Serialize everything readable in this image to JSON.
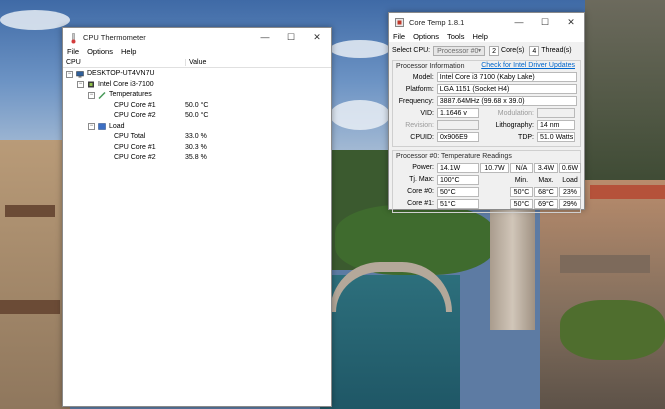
{
  "thermometer": {
    "title": "CPU Thermometer",
    "menu": [
      "File",
      "Options",
      "Help"
    ],
    "columns": {
      "name": "CPU",
      "value": "Value"
    },
    "tree": {
      "computer": "DESKTOP-UT4VN7U",
      "cpu": "Intel Core i3-7100",
      "temperatures_label": "Temperatures",
      "temperatures": [
        {
          "name": "CPU Core #1",
          "value": "50.0 °C"
        },
        {
          "name": "CPU Core #2",
          "value": "50.0 °C"
        }
      ],
      "load_label": "Load",
      "load": [
        {
          "name": "CPU Total",
          "value": "33.0 %"
        },
        {
          "name": "CPU Core #1",
          "value": "30.3 %"
        },
        {
          "name": "CPU Core #2",
          "value": "35.8 %"
        }
      ]
    }
  },
  "coretemp": {
    "title": "Core Temp 1.8.1",
    "menu": [
      "File",
      "Options",
      "Tools",
      "Help"
    ],
    "select_cpu_label": "Select CPU:",
    "select_cpu_value": "Processor #0",
    "cores_count": "2",
    "cores_label": "Core(s)",
    "threads_count": "4",
    "threads_label": "Thread(s)",
    "processor_info_label": "Processor Information",
    "driver_link": "Check for Intel Driver Updates",
    "model_label": "Model:",
    "model": "Intel Core i3 7100 (Kaby Lake)",
    "platform_label": "Platform:",
    "platform": "LGA 1151 (Socket H4)",
    "frequency_label": "Frequency:",
    "frequency": "3887.64MHz (99.68 x 39.0)",
    "vid_label": "VID:",
    "vid": "1.1646 v",
    "modulation_label": "Modulation:",
    "modulation": "",
    "revision_label": "Revision:",
    "revision": "",
    "lithography_label": "Lithography:",
    "lithography": "14 nm",
    "cpuid_label": "CPUID:",
    "cpuid": "0x906E9",
    "tdp_label": "TDP:",
    "tdp": "51.0 Watts",
    "temps_label": "Processor #0: Temperature Readings",
    "power_label": "Power:",
    "power": [
      "14.1W",
      "10.7W",
      "N/A",
      "3.4W",
      "0.6W"
    ],
    "tjmax_label": "Tj. Max:",
    "tjmax": "100°C",
    "min_label": "Min.",
    "max_label": "Max.",
    "load_label": "Load",
    "cores": [
      {
        "label": "Core #0:",
        "temp": "50°C",
        "min": "50°C",
        "max": "68°C",
        "load": "23%"
      },
      {
        "label": "Core #1:",
        "temp": "51°C",
        "min": "50°C",
        "max": "69°C",
        "load": "29%"
      }
    ]
  }
}
